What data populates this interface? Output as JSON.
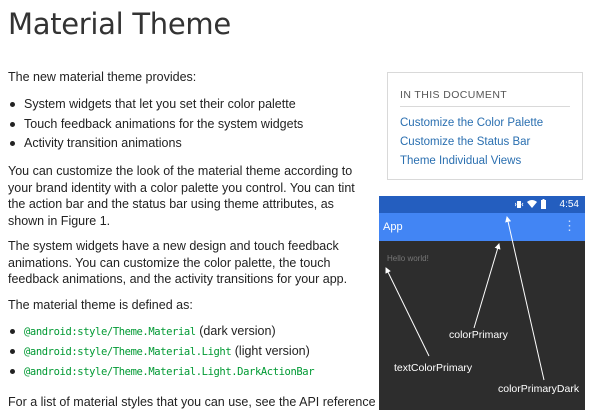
{
  "page": {
    "title": "Material Theme",
    "intro": "The new material theme provides:",
    "bullets": [
      "System widgets that let you set their color palette",
      "Touch feedback animations for the system widgets",
      "Activity transition animations"
    ],
    "para1": "You can customize the look of the material theme according to your brand identity with a color palette you control. You can tint the action bar and the status bar using theme attributes, as shown in Figure 1.",
    "para2": "The system widgets have a new design and touch feedback animations. You can customize the color palette, the touch feedback animations, and the activity transitions for your app.",
    "para3": "The material theme is defined as:",
    "themes": [
      {
        "code": "@android:style/Theme.Material",
        "note": "(dark version)"
      },
      {
        "code": "@android:style/Theme.Material.Light",
        "note": "(light version)"
      },
      {
        "code": "@android:style/Theme.Material.Light.DarkActionBar",
        "note": ""
      }
    ],
    "para4": "For a list of material styles that you can use, see the API reference"
  },
  "toc": {
    "heading": "IN THIS DOCUMENT",
    "links": [
      "Customize the Color Palette",
      "Customize the Status Bar",
      "Theme Individual Views"
    ]
  },
  "figure": {
    "status_time": "4:54",
    "app_title": "App",
    "hello_text": "Hello world!",
    "labels": {
      "color_primary": "colorPrimary",
      "text_color_primary": "textColorPrimary",
      "color_primary_dark": "colorPrimaryDark"
    },
    "colors": {
      "status_bar": "#245ebf",
      "action_bar": "#4285f4",
      "background": "#2d2d2d"
    }
  },
  "colors": {
    "link": "#2a6fb0",
    "code": "#009933"
  }
}
